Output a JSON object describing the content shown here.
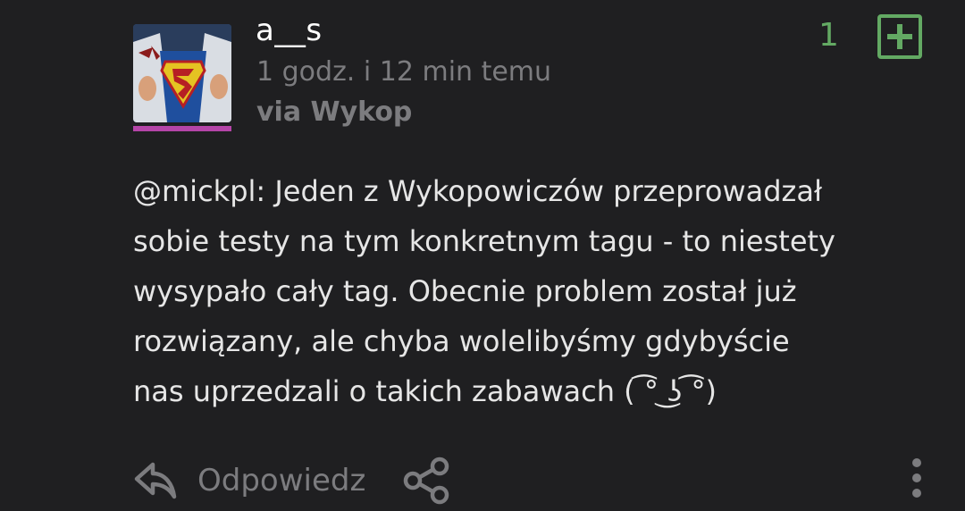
{
  "entry": {
    "username": "a__s",
    "timestamp": "1 godz. i 12 min temu",
    "source": "via Wykop",
    "vote_count": "1",
    "body": "@mickpl: Jeden z Wykopowiczów przeprowadzał\nsobie testy na tym konkretnym tagu - to niestety\nwysypało cały tag. Obecnie problem został już\nrozwiązany, ale chyba wolelibyśmy gdybyście\nnas uprzedzali o takich zabawach ( ͡° ͜ʖ ͡°)",
    "avatar_icon": "superman-avatar",
    "accent_color": "#b545a8",
    "vote_color": "#63a963"
  },
  "actions": {
    "reply_label": "Odpowiedz",
    "reply_icon": "reply-arrow-icon",
    "share_icon": "share-icon",
    "more_icon": "more-vertical-icon"
  }
}
